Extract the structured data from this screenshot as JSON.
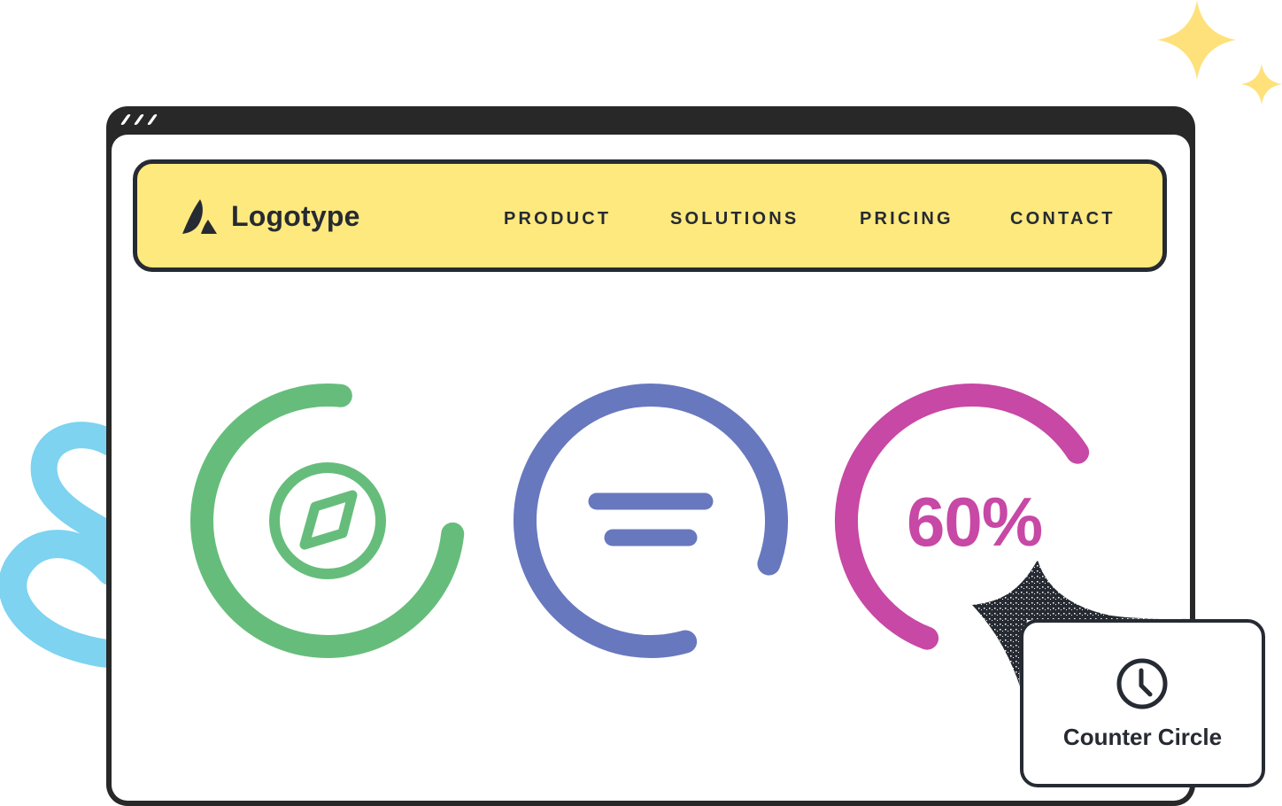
{
  "window": {
    "titlebar_icon": "window-controls-icon"
  },
  "navbar": {
    "logo_icon": "logo-mark-icon",
    "logo_text": "Logotype",
    "items": [
      {
        "label": "PRODUCT"
      },
      {
        "label": "SOLUTIONS"
      },
      {
        "label": "PRICING"
      },
      {
        "label": "CONTACT"
      }
    ]
  },
  "counters": [
    {
      "name": "compass-counter",
      "icon": "compass-icon",
      "progress": 0.75,
      "color": "#66BD7B"
    },
    {
      "name": "menu-counter",
      "icon": "menu-lines-icon",
      "progress": 0.85,
      "color": "#6878BE"
    },
    {
      "name": "percent-counter",
      "label": "60%",
      "progress": 0.6,
      "color": "#C748A5"
    }
  ],
  "card": {
    "icon": "clock-icon",
    "label": "Counter Circle"
  },
  "colors": {
    "navbar_bg": "#FEE97E",
    "frame": "#282828",
    "text_dark": "#262A32",
    "sparkle": "#FEE17A",
    "squiggle": "#7DD3F0"
  }
}
